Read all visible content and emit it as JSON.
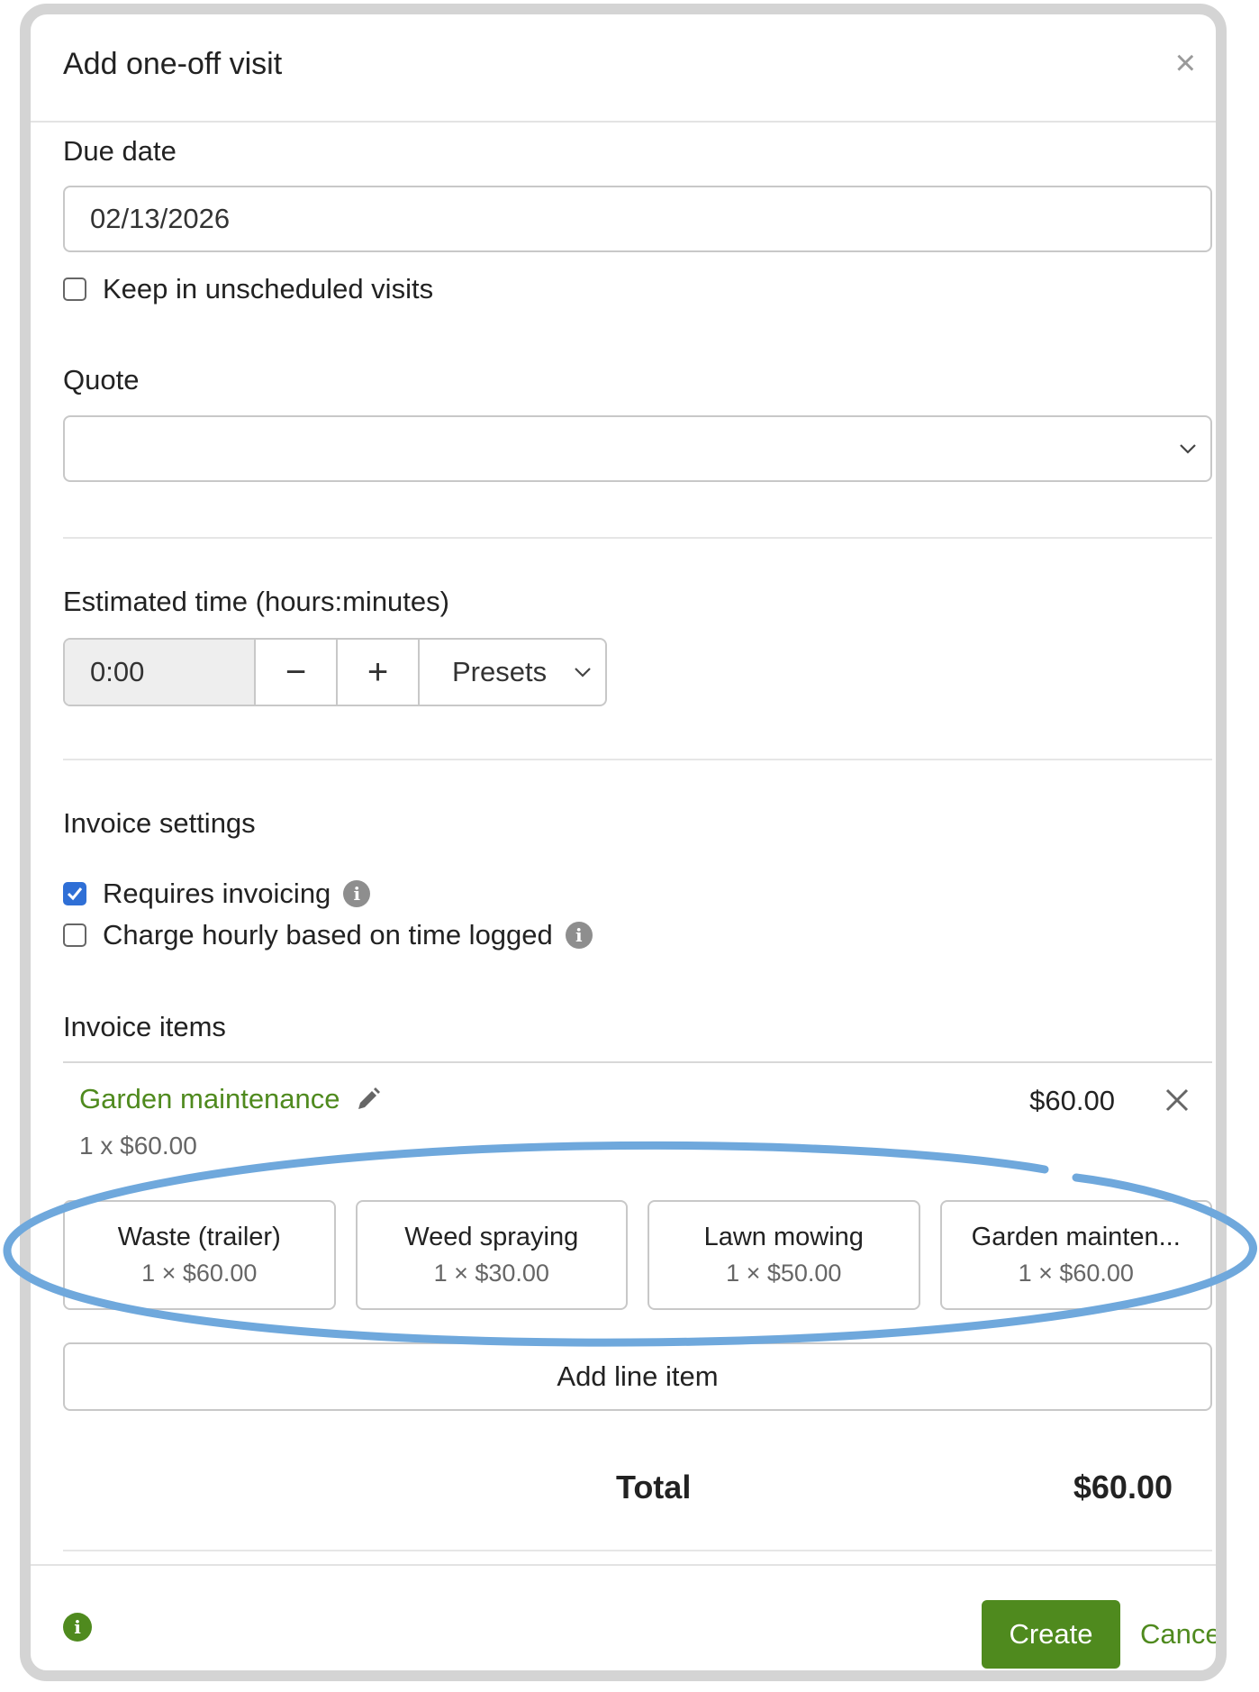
{
  "dialog": {
    "title": "Add one-off visit",
    "close_icon": "×"
  },
  "due_date": {
    "label": "Due date",
    "value": "02/13/2026",
    "keep_unscheduled_label": "Keep in unscheduled visits",
    "keep_unscheduled_checked": false
  },
  "quote": {
    "label": "Quote",
    "selected": ""
  },
  "estimated_time": {
    "label": "Estimated time (hours:minutes)",
    "value": "0:00",
    "decrement": "−",
    "increment": "+",
    "presets_label": "Presets"
  },
  "invoice_settings": {
    "heading": "Invoice settings",
    "requires_invoicing_label": "Requires invoicing",
    "requires_invoicing_checked": true,
    "charge_hourly_label": "Charge hourly based on time logged",
    "charge_hourly_checked": false,
    "info_glyph": "i"
  },
  "invoice_items": {
    "heading": "Invoice items",
    "items": [
      {
        "name": "Garden maintenance",
        "qty_text": "1 x $60.00",
        "price": "$60.00"
      }
    ],
    "presets": [
      {
        "name": "Waste (trailer)",
        "price": "1 × $60.00"
      },
      {
        "name": "Weed spraying",
        "price": "1 × $30.00"
      },
      {
        "name": "Lawn mowing",
        "price": "1 × $50.00"
      },
      {
        "name": "Garden mainten...",
        "price": "1 × $60.00"
      }
    ],
    "add_line_item": "Add line item",
    "total_label": "Total",
    "total_value": "$60.00"
  },
  "footer": {
    "info_glyph": "i",
    "create_label": "Create",
    "cancel_label": "Cancel"
  },
  "colors": {
    "accent_green": "#4f8a1e",
    "checkbox_blue": "#2f6fd6",
    "highlight_oval": "#6fa8dc"
  }
}
